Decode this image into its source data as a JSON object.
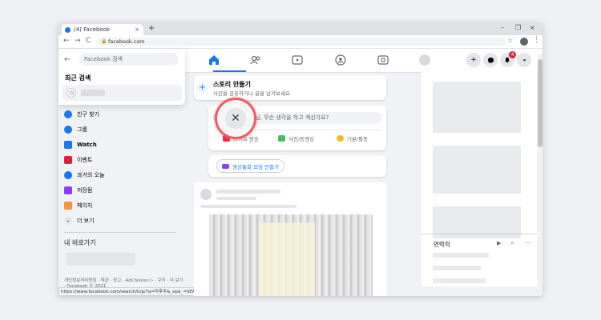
{
  "browser": {
    "tab_title": "(4) Facebook",
    "tab_close": "×",
    "new_tab": "+",
    "url": "facebook.com",
    "window_minimize": "–",
    "window_restore": "❐",
    "window_close": "×",
    "back": "←",
    "forward": "→",
    "reload": "C",
    "status_url": "https://www.facebook.com/search/top/?q=미후주&_epa_=SEARCH_BOX"
  },
  "search": {
    "placeholder": "Facebook 검색",
    "recent_title": "최근 검색"
  },
  "sidebar": {
    "items": [
      {
        "label": "친구 찾기",
        "color": "#1877f2"
      },
      {
        "label": "그룹",
        "color": "#1877f2"
      },
      {
        "label": "Watch",
        "color": "#1877f2"
      },
      {
        "label": "이벤트",
        "color": "#e41e3f"
      },
      {
        "label": "과거의 오늘",
        "color": "#1877f2"
      },
      {
        "label": "저장됨",
        "color": "#8a3ffc"
      },
      {
        "label": "페이지",
        "color": "#f7923b"
      },
      {
        "label": "더 보기",
        "color": "#65676b"
      }
    ],
    "shortcuts_title": "내 바로가기",
    "footer": "개인정보처리방침 · 약관 · 광고 · AdChoices ▷ · 쿠키 · 더 보기 · Facebook © 2021"
  },
  "topnav": {
    "notification_count": "4",
    "accent": "#1877f2"
  },
  "story": {
    "title": "스토리 만들기",
    "subtitle": "사진을 공유하거나 글을 남겨보세요."
  },
  "composer": {
    "prompt": "님, 무슨 생각을 하고 계신가요?",
    "actions": [
      {
        "label": "라이브 방송",
        "color": "#f02849"
      },
      {
        "label": "사진/동영상",
        "color": "#45bd62"
      },
      {
        "label": "기분/활동",
        "color": "#f7b928"
      }
    ]
  },
  "room": {
    "label": "영상통화 모임 만들기"
  },
  "contacts": {
    "title": "연락처"
  }
}
